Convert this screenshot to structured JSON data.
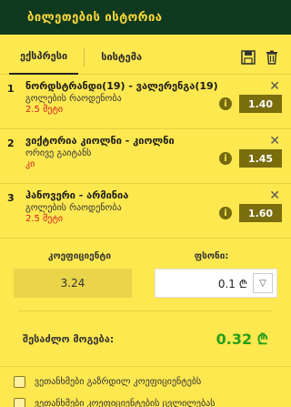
{
  "header": {
    "title": "ბილეთების ისტორია"
  },
  "tabs": {
    "express": "ექსპრესი",
    "system": "სისტემა"
  },
  "bets": [
    {
      "num": "1",
      "title": "ნორდსტრანდი(19) - ვალერენგა(19)",
      "market": "გოლების რაოდენობა",
      "selection": "2.5 მეტი",
      "odds": "1.40"
    },
    {
      "num": "2",
      "title": "ვიქტორია კიოლნი - კიოლნი",
      "market": "ორივე გაიტანს",
      "selection": "კი",
      "odds": "1.45"
    },
    {
      "num": "3",
      "title": "ჰანოვერი - არმინია",
      "market": "გოლების რაოდენობა",
      "selection": "2.5 მეტი",
      "odds": "1.60"
    }
  ],
  "totals": {
    "coef_label": "კოეფიციენტი",
    "coef_value": "3.24",
    "stake_label": "ფსონი:",
    "stake_value": "0.1 ₾"
  },
  "win": {
    "label": "შესაძლო მოგება:",
    "value": "0.32 ₾"
  },
  "options": [
    "ვეთანხმები გაზრდილ კოეფიციენტებს",
    "ვეთანხმები კოეფიციენტების ცვლილებას"
  ],
  "colors": {
    "header_bg": "#0f3a1f",
    "body_bg": "#fde84f",
    "odds_bg": "#7a6d0d",
    "win_green": "#2a9e1a",
    "selection_red": "#d21f1f"
  }
}
